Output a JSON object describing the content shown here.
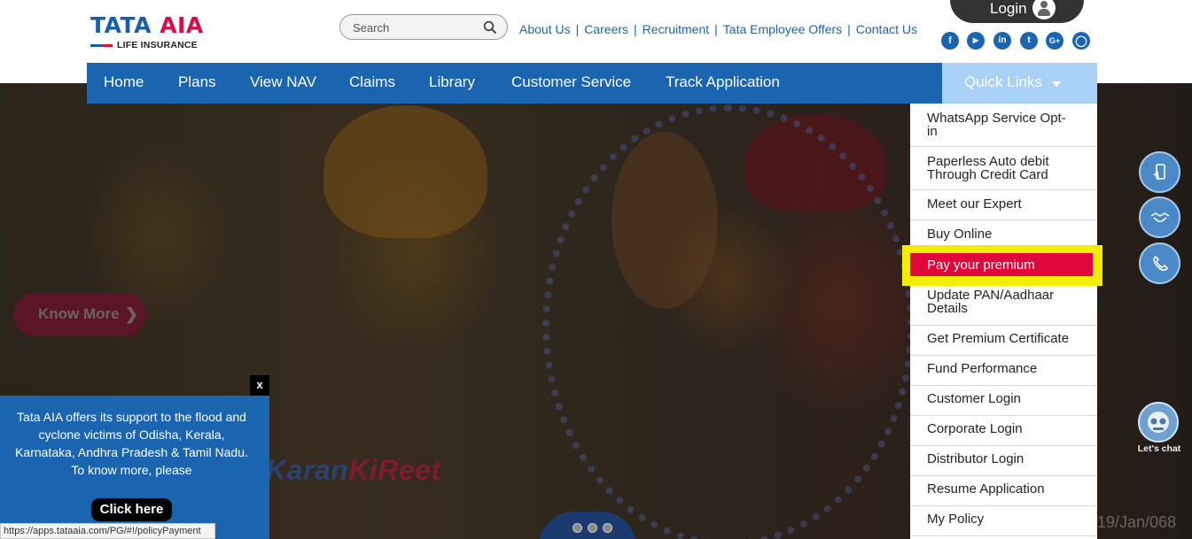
{
  "brand": {
    "main_left": "TATA",
    "main_right": "AIA",
    "sub": "LIFE INSURANCE"
  },
  "search": {
    "placeholder": "Search"
  },
  "top_links": [
    "About Us",
    "Careers",
    "Recruitment",
    "Tata Employee Offers",
    "Contact Us"
  ],
  "login": {
    "label": "Login"
  },
  "social": [
    "facebook-icon",
    "youtube-icon",
    "linkedin-icon",
    "twitter-icon",
    "google-plus-icon",
    "instagram-icon"
  ],
  "nav": {
    "items": [
      "Home",
      "Plans",
      "View NAV",
      "Claims",
      "Library",
      "Customer Service",
      "Track Application"
    ],
    "quick_links": "Quick Links"
  },
  "hero": {
    "button_label": "Know More",
    "tagline_part1": "Karan",
    "tagline_part2": "KiReet",
    "date_fragment": "19/Jan/068"
  },
  "quick_links_menu": [
    {
      "label": "WhatsApp Service Opt-\nin"
    },
    {
      "label": "Paperless Auto debit\nThrough Credit Card"
    },
    {
      "label": "Meet our Expert"
    },
    {
      "label": "Buy Online"
    },
    {
      "label": "Pay your premium",
      "highlighted": true
    },
    {
      "label": "Update PAN/Aadhaar\nDetails"
    },
    {
      "label": "Get Premium Certificate"
    },
    {
      "label": "Fund Performance"
    },
    {
      "label": "Customer Login"
    },
    {
      "label": "Corporate Login"
    },
    {
      "label": "Distributor Login"
    },
    {
      "label": "Resume Application"
    },
    {
      "label": "My Policy"
    }
  ],
  "floating": {
    "chat_label": "Let's chat"
  },
  "notice": {
    "text": "Tata AIA offers its support to the flood and cyclone victims of Odisha, Kerala, Karnataka, Andhra Pradesh & Tamil Nadu. To know more, please",
    "button": "Click here",
    "close": "x"
  },
  "status_url": "https://apps.tataaia.com/PG/#!/policyPayment",
  "colors": {
    "brand_blue": "#1a64b0",
    "brand_red": "#d31145",
    "highlight_red": "#e1063c",
    "highlight_yellow": "#f3ed05",
    "quick_links_bg": "#a9d0f5"
  }
}
